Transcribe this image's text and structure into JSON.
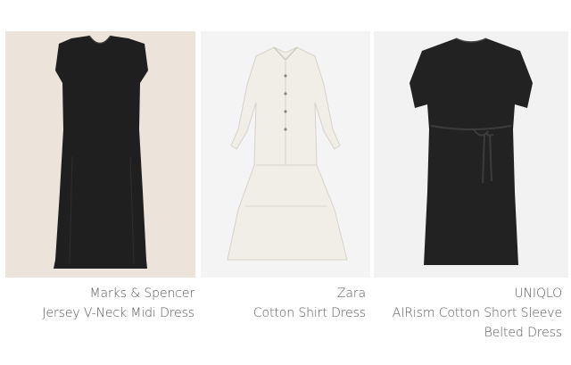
{
  "products": [
    {
      "brand": "Marks & Spencer",
      "name_lines": [
        "Jersey V-Neck Midi Dress"
      ],
      "dress_color": "#1f1f1f",
      "background_color": "#ece4da",
      "image_icon": "black-vneck-midi-dress-icon"
    },
    {
      "brand": "Zara",
      "name_lines": [
        "Cotton Shirt Dress"
      ],
      "dress_color": "#f4f1ea",
      "background_color": "#f4f4f4",
      "image_icon": "white-cotton-shirt-dress-icon"
    },
    {
      "brand": "UNIQLO",
      "name_lines": [
        "AIRism Cotton Short Sleeve",
        "Belted Dress"
      ],
      "dress_color": "#222222",
      "background_color": "#f2f2f2",
      "image_icon": "black-belted-tshirt-dress-icon"
    }
  ]
}
